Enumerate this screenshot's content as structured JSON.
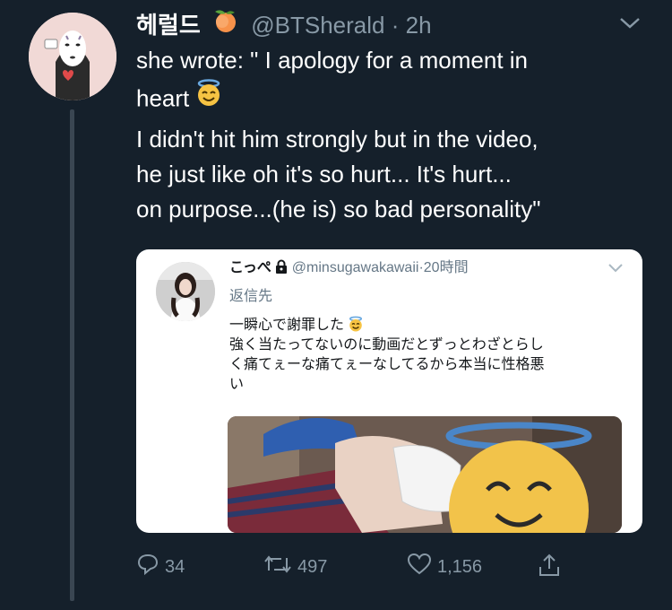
{
  "tweet": {
    "author_name": "헤럴드",
    "handle": "@BTSherald",
    "separator": "·",
    "time": "2h",
    "text_lines": [
      "she wrote: \" I apology for a moment in",
      "heart",
      "I didn't hit him strongly but in the video,",
      "he just like oh it's so hurt... It's hurt...",
      "on purpose...(he is) so bad personality\""
    ]
  },
  "quoted": {
    "author_name": "こっぺ",
    "handle": "@minsugawakawaii",
    "separator": "·",
    "time": "20時間",
    "reply_label": "返信先",
    "text_lines": [
      "一瞬心で謝罪した",
      "強く当たってないのに動画だとずっとわざとらし",
      "く痛てぇーな痛てぇーなしてるから本当に性格悪",
      "い"
    ]
  },
  "actions": {
    "reply_count": "34",
    "retweet_count": "497",
    "like_count": "1,156"
  },
  "icons": {
    "author_badge": "peach-emoji-icon",
    "halo_emoji": "smiling-face-with-halo-icon",
    "lock": "lock-icon",
    "chevron": "chevron-down-icon",
    "reply": "reply-icon",
    "retweet": "retweet-icon",
    "like": "heart-icon",
    "share": "share-icon"
  },
  "colors": {
    "background": "#15202b",
    "muted": "#8899a6",
    "card": "#ffffff"
  }
}
